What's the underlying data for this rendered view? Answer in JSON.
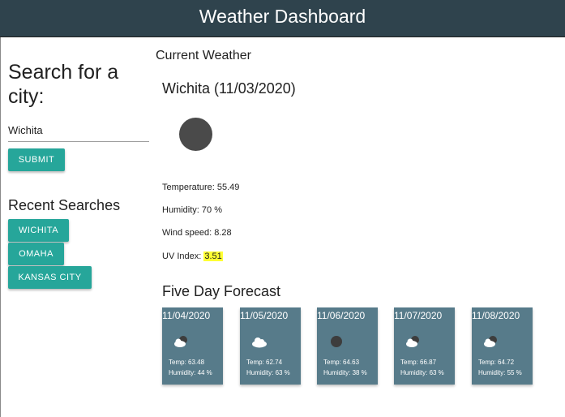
{
  "header": {
    "title": "Weather Dashboard"
  },
  "sidebar": {
    "search_title": "Search for a city:",
    "search_value": "Wichita",
    "submit_label": "SUBMIT",
    "recent_title": "Recent Searches",
    "recent": [
      "WICHITA",
      "OMAHA",
      "KANSAS CITY"
    ]
  },
  "current": {
    "section_title": "Current Weather",
    "city_date": "Wichita (11/03/2020)",
    "icon": "dark-circle-icon",
    "temperature_label": "Temperature: 55.49",
    "humidity_label": "Humidity: 70 %",
    "wind_label": "Wind speed: 8.28",
    "uv_prefix": "UV Index: ",
    "uv_value": "3.51"
  },
  "forecast": {
    "title": "Five Day Forecast",
    "days": [
      {
        "date": "11/04/2020",
        "icon": "partly-cloudy-night-icon",
        "temp": "Temp: 63.48",
        "humidity": "Humidity: 44 %"
      },
      {
        "date": "11/05/2020",
        "icon": "cloud-icon",
        "temp": "Temp: 62.74",
        "humidity": "Humidity: 63 %"
      },
      {
        "date": "11/06/2020",
        "icon": "dark-circle-icon",
        "temp": "Temp: 64.63",
        "humidity": "Humidity: 38 %"
      },
      {
        "date": "11/07/2020",
        "icon": "partly-cloudy-night-icon",
        "temp": "Temp: 66.87",
        "humidity": "Humidity: 63 %"
      },
      {
        "date": "11/08/2020",
        "icon": "partly-cloudy-night-icon",
        "temp": "Temp: 64.72",
        "humidity": "Humidity: 55 %"
      }
    ]
  },
  "colors": {
    "header_bg": "#2f434d",
    "accent": "#26a69a",
    "card_bg": "#577b8a",
    "uv_highlight": "#ffff33"
  }
}
